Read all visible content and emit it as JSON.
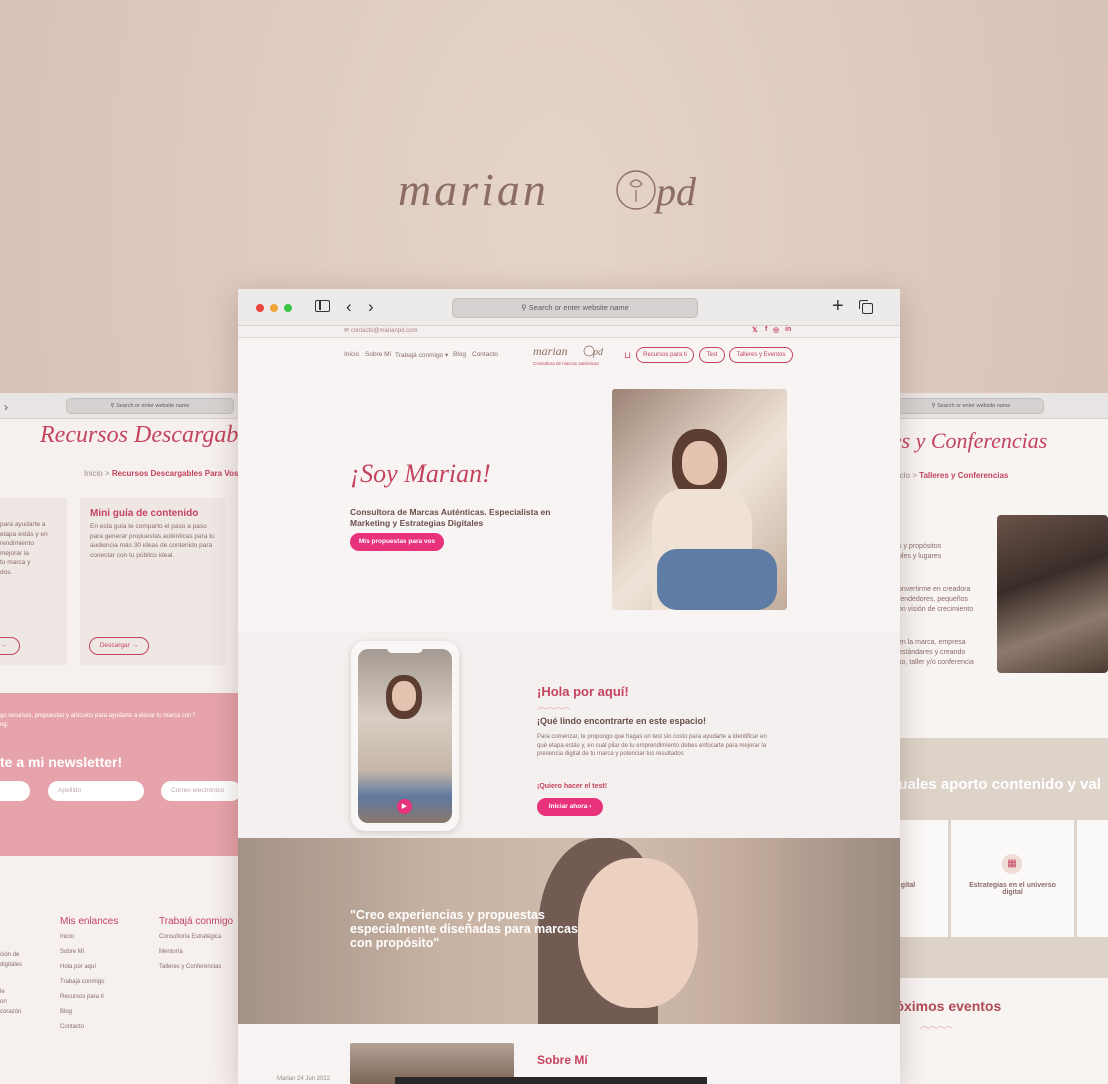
{
  "brand": {
    "logo_text": "marianpd"
  },
  "colors": {
    "accent": "#c4435f",
    "pink": "#e8337c",
    "blush": "#e6a3ab"
  },
  "left_window": {
    "address": "Search or enter website name",
    "title": "Recursos Descargables Para",
    "breadcrumb": {
      "home": "Inicio",
      "sep": ">",
      "current": "Recursos Descargables Para Vos"
    },
    "card1": {
      "text": "para ayudarte a\netapa estás y en\nrendimiento\nmejorar la\ntu marca y\ndos.",
      "button": "→"
    },
    "card2": {
      "title": "Mini guía de contenido",
      "text": "En esta guía te comparto el paso a paso para generar propuestas auténticas para tu audiencia más 30 ideas de contenido para conectar con tu público ideal.",
      "button": "Descargar →"
    },
    "newsletter": {
      "text": "go recursos, propuestas y artículos para ayudarte a elevar tu marca con f\nng.",
      "title": "te a mi newsletter!",
      "lastname_placeholder": "Apellido",
      "email_placeholder": "Correo electrónico"
    },
    "footer": {
      "col1": [
        "ción de",
        "digitales",
        "",
        "le",
        "on",
        "corazón"
      ],
      "links_title": "Mis enlances",
      "links": [
        "Inicio",
        "Sobre Mí",
        "Hola por aquí",
        "Trabajá conmigo",
        "Recursos para ti",
        "Blog",
        "Contacto"
      ],
      "work_title": "Trabajá conmigo",
      "work": [
        "Consultoría Estratégica",
        "Mentoría",
        "Talleres y Conferencias"
      ]
    }
  },
  "right_window": {
    "address": "Search or enter website name",
    "title": "res y Conferencias",
    "breadcrumb": {
      "home": "icio",
      "sep": ">",
      "current": "Talleres y Conferencias"
    },
    "lines1": [
      "s y propósitos",
      "bles y lugares"
    ],
    "lines2": [
      "onvertirme en creadora",
      "rendedores, pequeños",
      "on visión de crecimiento"
    ],
    "lines3": [
      "en la marca, empresa",
      "estándares y creando",
      "so, taller y/o conferencia"
    ],
    "band_title": "cuales aporto contenido y val",
    "card_left": "gital",
    "card_mid": "Estrategias en el universo digital",
    "events_title": "róximos eventos"
  },
  "main_window": {
    "address": "Search or enter website name",
    "email": "contacto@marianpd.com",
    "social": [
      "𝕏",
      "f",
      "◎",
      "in"
    ],
    "nav": [
      "Inicio",
      "Sobre Mí",
      "Trabajá conmigo ▾",
      "Blog",
      "Contacto"
    ],
    "logo_tagline": "Consultora de marcas auténticas",
    "pills": [
      "Recursos para ti",
      "Test",
      "Talleres y Eventos"
    ],
    "hero": {
      "name": "¡Soy Marian!",
      "subtitle": "Consultora de Marcas Auténticas. Especialista en Marketing y Estrategias Digitales",
      "button": "Mis propuestas para vos"
    },
    "hola": {
      "title": "¡Hola por aquí!",
      "subtitle": "¡Qué lindo encontrarte en este espacio!",
      "text": "Para comenzar, te propongo que hagas un test sin costo para ayudarte a identificar en qué etapa estás y, en cuál pilar de tu emprendimiento debes enfocarte para mejorar la presencia digital de tu marca y potenciar tus resultados",
      "link": "¡Quiero hacer el test!",
      "button": "Iniciar ahora ›"
    },
    "quote": "\"Creo experiencias y propuestas especialmente diseñadas para marcas con propósito\"",
    "about_title": "Sobre Mí"
  },
  "footer_date": "Marian  24 Jun 2022"
}
